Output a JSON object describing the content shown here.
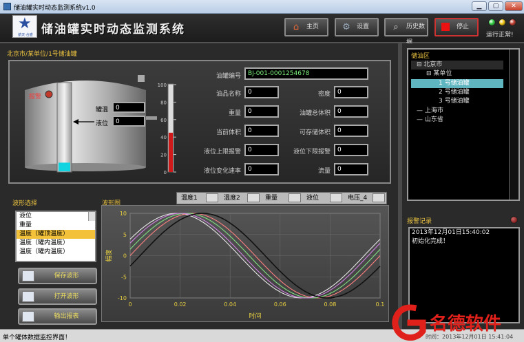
{
  "window": {
    "title": "储油罐实时动态监测系统v1.0",
    "min": "▁",
    "max": "▢",
    "close": "✕"
  },
  "header": {
    "logo_text": "航天·合盛",
    "title": "储油罐实时动态监测系统",
    "buttons": [
      {
        "label": "主页",
        "icon": "home-icon"
      },
      {
        "label": "设置",
        "icon": "gear-icon"
      },
      {
        "label": "历史数据",
        "icon": "search-icon"
      },
      {
        "label": "停止",
        "icon": "stop-icon"
      }
    ],
    "lamps": [
      "#2ecc40",
      "#f1c40f",
      "#c0392b"
    ],
    "status": "运行正常!"
  },
  "tank": {
    "breadcrumb": "北京市/某单位/1号储油罐",
    "alarm_label": "报警",
    "temp_label": "罐温",
    "temp_value": "0",
    "level_label": "液位",
    "level_value": "0",
    "level_fill": 0.1,
    "thermo_fill": 0.45,
    "thermo_ticks": [
      "100",
      "80",
      "60",
      "40",
      "20",
      "0"
    ],
    "fields": {
      "id_label": "油罐编号",
      "id_value": "BJ-001-0001254678",
      "oil_name_label": "油品名称",
      "oil_name_value": "0",
      "density_label": "密度",
      "density_value": "0",
      "weight_label": "重量",
      "weight_value": "0",
      "total_vol_label": "油罐总体积",
      "total_vol_value": "0",
      "cur_vol_label": "当前体积",
      "cur_vol_value": "0",
      "avail_vol_label": "可存储体积",
      "avail_vol_value": "0",
      "upper_alarm_label": "液位上限报警",
      "upper_alarm_value": "0",
      "lower_alarm_label": "液位下限报警",
      "lower_alarm_value": "0",
      "rate_label": "液位变化速率",
      "rate_value": "0",
      "flow_label": "流量",
      "flow_value": "0"
    }
  },
  "wave": {
    "select_label": "波形选择",
    "options": [
      "液位",
      "重量",
      "温度（罐顶温度）",
      "温度（罐内温度）",
      "温度（罐内温度）"
    ],
    "selected_index": 2,
    "buttons": [
      {
        "label": "保存波形"
      },
      {
        "label": "打开波形"
      },
      {
        "label": "输出报表"
      }
    ]
  },
  "chart_data": {
    "type": "line",
    "title": "波形图",
    "xlabel": "时间",
    "ylabel": "幅度",
    "xlim": [
      0,
      0.1
    ],
    "ylim": [
      -10,
      10
    ],
    "xticks": [
      "0",
      "0.02",
      "0.04",
      "0.06",
      "0.08",
      "0.1"
    ],
    "yticks": [
      "10",
      "5",
      "0",
      "-5",
      "-10"
    ],
    "series": [
      {
        "name": "温度1",
        "color": "#111111",
        "phase": -0.6
      },
      {
        "name": "温度2",
        "color": "#ff8080",
        "phase": -0.35
      },
      {
        "name": "重量",
        "color": "#80e080",
        "phase": -0.2
      },
      {
        "name": "液位",
        "color": "#e8e8e8",
        "phase": 0.05
      },
      {
        "name": "电压_4",
        "color": "#d080e0",
        "phase": -0.05
      }
    ],
    "amplitude": 10,
    "period": 0.1
  },
  "tree": {
    "title": "储油区",
    "items": [
      {
        "label": "北京市",
        "indent": 0,
        "prefix": "⊟"
      },
      {
        "label": "某单位",
        "indent": 1,
        "prefix": "⊟"
      },
      {
        "label": "1 号储油罐",
        "indent": 2,
        "prefix": ""
      },
      {
        "label": "2 号储油罐",
        "indent": 2,
        "prefix": ""
      },
      {
        "label": "3 号储油罐",
        "indent": 2,
        "prefix": ""
      },
      {
        "label": "上海市",
        "indent": 0,
        "prefix": ""
      },
      {
        "label": "山东省",
        "indent": 0,
        "prefix": ""
      }
    ],
    "selected_index": 2
  },
  "alarm": {
    "title": "报警记录",
    "lines": [
      "2013年12月01日15:40:02",
      "初始化完成！"
    ]
  },
  "statusbar": {
    "text": "单个罐体数据监控界面！",
    "time": "时间：2013年12月01日  15:41:04"
  },
  "watermark": {
    "text": "名德软件"
  }
}
